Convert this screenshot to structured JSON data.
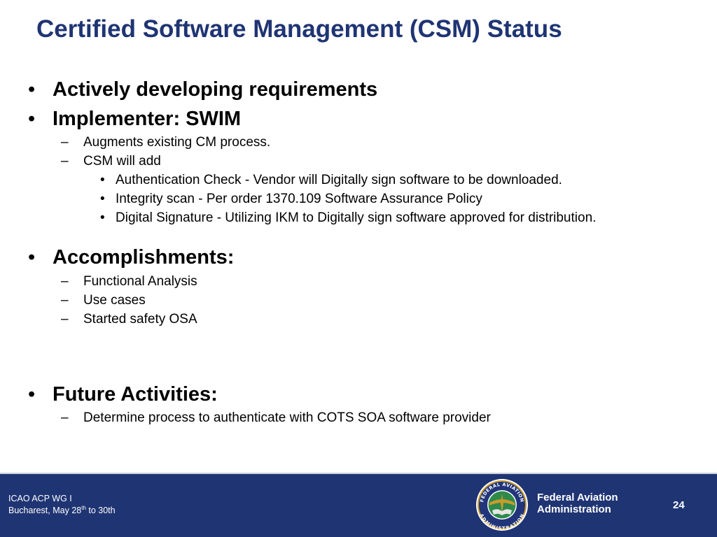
{
  "title": "Certified Software Management (CSM) Status",
  "markers": {
    "bullet": "•",
    "dash": "–"
  },
  "bullets": {
    "b1": "Actively developing requirements",
    "b2": "Implementer: SWIM",
    "b2_sub1": "Augments existing CM process.",
    "b2_sub2": "CSM will add",
    "b2_sub2_items": [
      "Authentication Check -  Vendor will Digitally sign software to be downloaded.",
      "Integrity scan - Per order 1370.109 Software Assurance Policy",
      "Digital Signature - Utilizing IKM to Digitally sign software approved for distribution."
    ],
    "b3": "Accomplishments:",
    "b3_subs": [
      "Functional Analysis",
      "Use cases",
      "Started safety OSA"
    ],
    "b4": "Future Activities:",
    "b4_subs": [
      "Determine process to authenticate with COTS SOA software provider"
    ]
  },
  "footer": {
    "line1": "ICAO ACP WG I",
    "line2_pre": "Bucharest, May 28",
    "line2_sup": "th",
    "line2_post": " to 30th",
    "agency_line1": "Federal Aviation",
    "agency_line2": "Administration",
    "page": "24",
    "seal_text_top": "FEDERAL AVIATION",
    "seal_text_bottom": "ADMINISTRATION",
    "colors": {
      "navy": "#1f3473",
      "title": "#1f3473"
    }
  }
}
